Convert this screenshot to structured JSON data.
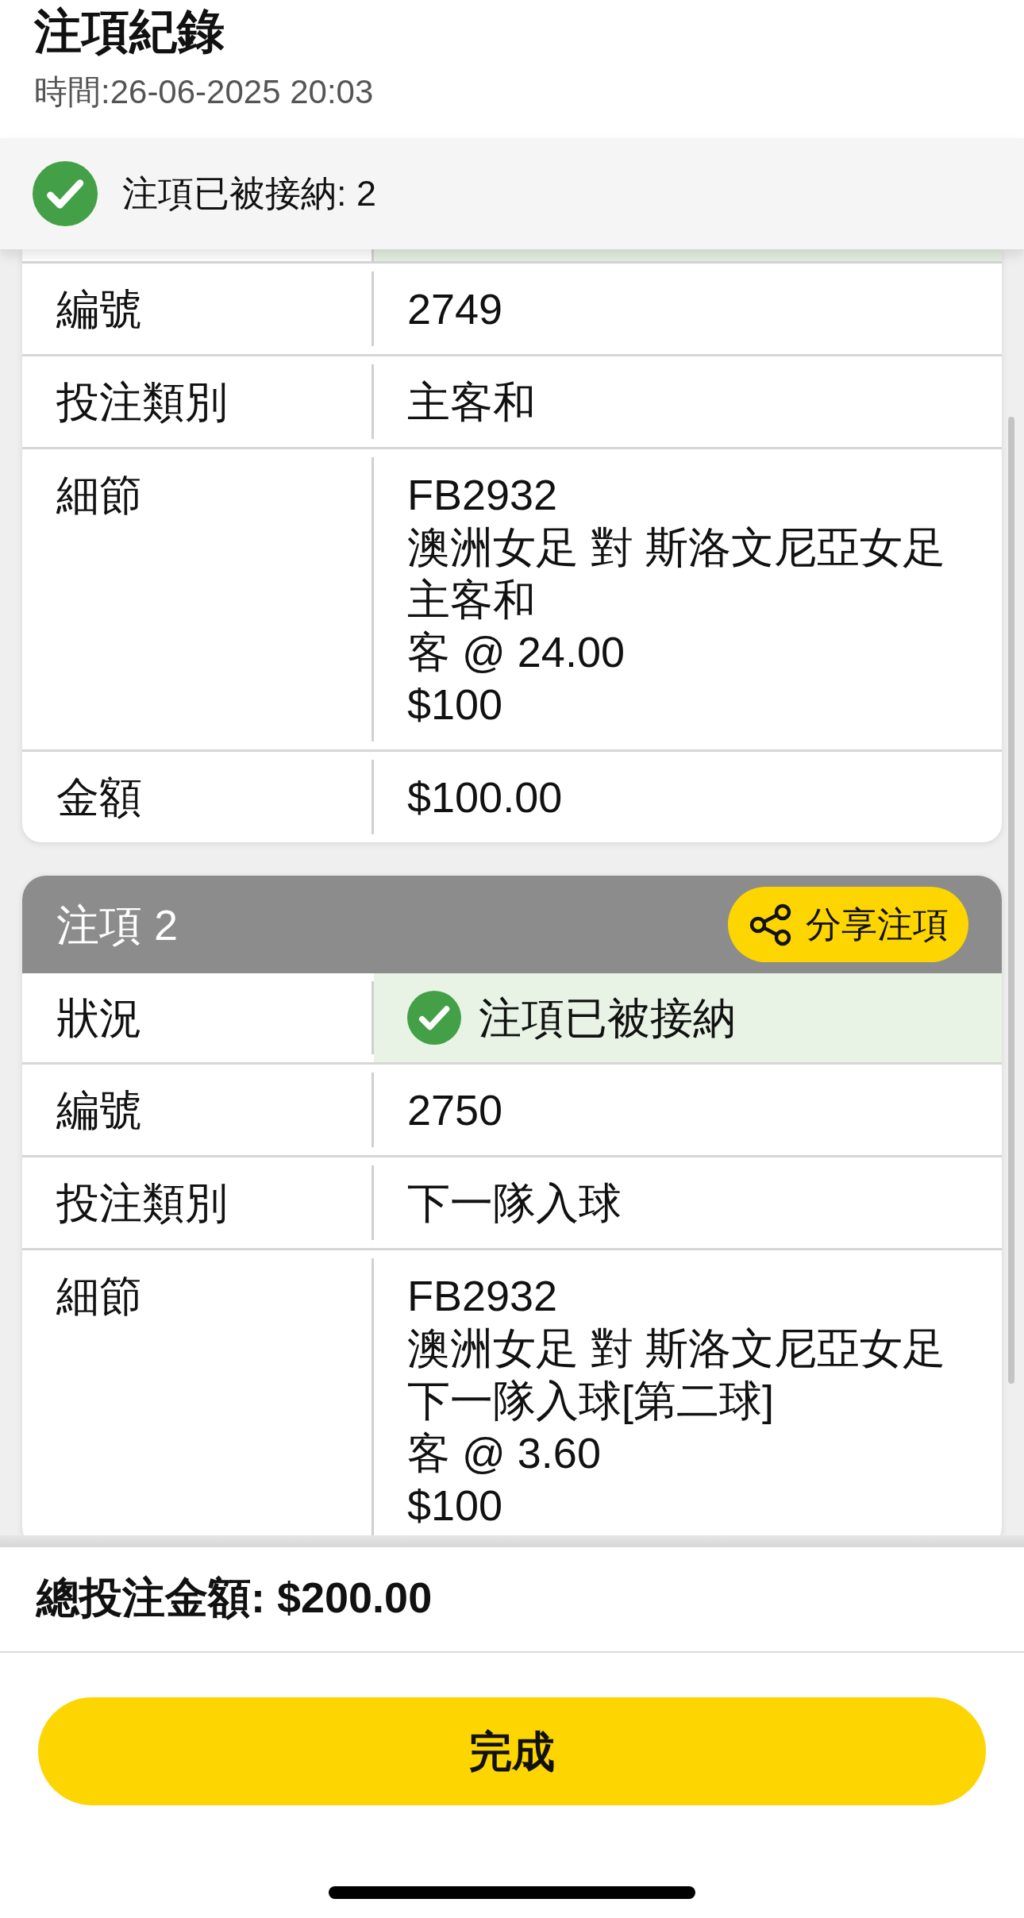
{
  "header": {
    "title": "注項紀錄",
    "time": "時間:26-06-2025 20:03"
  },
  "banner": {
    "text": "注項已被接納: 2"
  },
  "bets": [
    {
      "rows": [
        {
          "kind": "status",
          "clipped": true
        },
        {
          "kind": "text",
          "label": "編號",
          "value": "2749"
        },
        {
          "kind": "text",
          "label": "投注類別",
          "value": "主客和"
        },
        {
          "kind": "lines",
          "label": "細節",
          "lines": [
            "FB2932",
            "澳洲女足 對 斯洛文尼亞女足",
            "主客和",
            "客 @ 24.00",
            "$100"
          ]
        },
        {
          "kind": "text",
          "label": "金額",
          "value": "$100.00"
        }
      ]
    },
    {
      "title": "注項 2",
      "share_button": "分享注項",
      "rows": [
        {
          "kind": "status",
          "clipped": false,
          "label": "狀況",
          "value": "注項已被接納"
        },
        {
          "kind": "text",
          "label": "編號",
          "value": "2750"
        },
        {
          "kind": "text",
          "label": "投注類別",
          "value": "下一隊入球"
        },
        {
          "kind": "lines",
          "label": "細節",
          "lines": [
            "FB2932",
            "澳洲女足 對 斯洛文尼亞女足",
            "下一隊入球[第二球]",
            "客 @ 3.60",
            "$100"
          ]
        }
      ]
    }
  ],
  "footer": {
    "total": "總投注金額: $200.00",
    "done_button": "完成"
  }
}
